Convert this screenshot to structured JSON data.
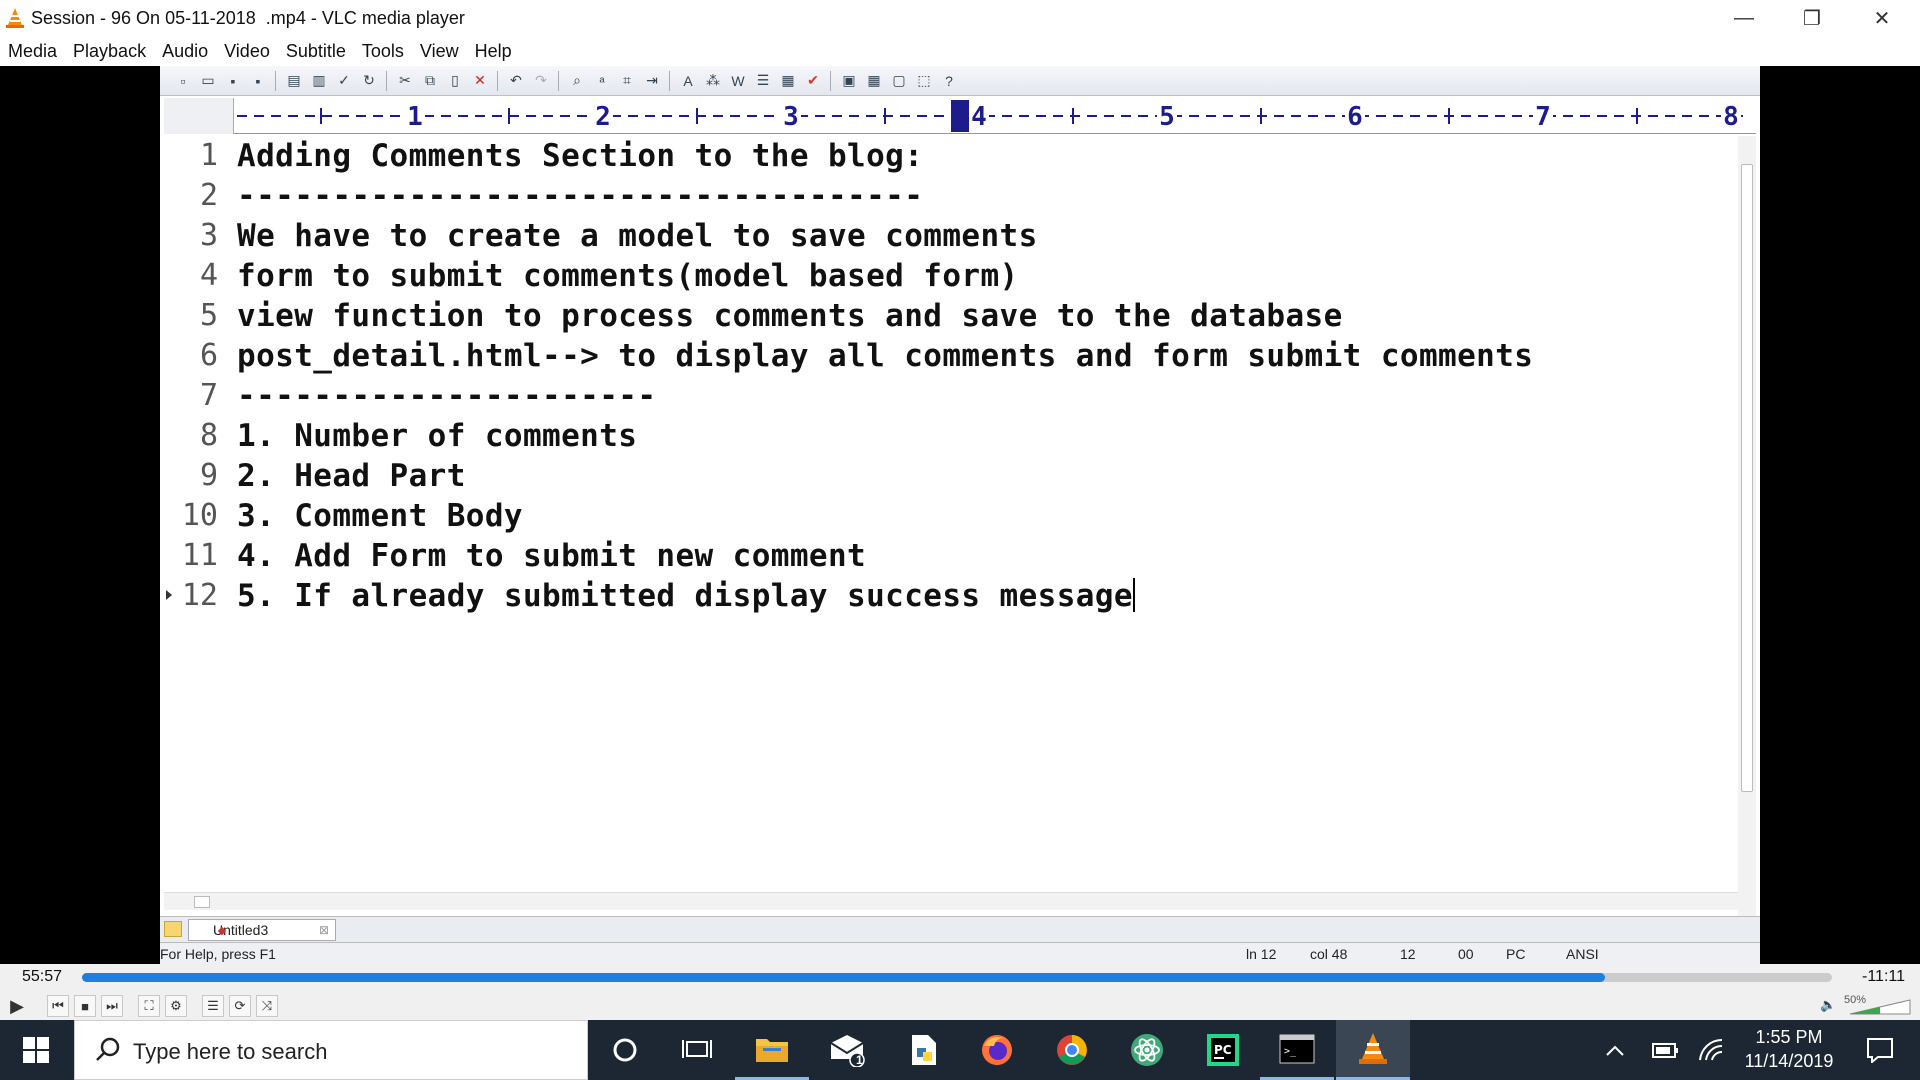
{
  "window": {
    "title": "Session - 96 On 05-11-2018  .mp4 - VLC media player",
    "minimize": "—",
    "restore": "❐",
    "close": "✕"
  },
  "menu": [
    "Media",
    "Playback",
    "Audio",
    "Video",
    "Subtitle",
    "Tools",
    "View",
    "Help"
  ],
  "editor": {
    "ruler_numbers": [
      "1",
      "2",
      "3",
      "4",
      "5",
      "6",
      "7",
      "8"
    ],
    "lines": [
      {
        "n": "1",
        "text": "Adding Comments Section to the blog:"
      },
      {
        "n": "2",
        "text": "------------------------------------"
      },
      {
        "n": "3",
        "text": "We have to create a model to save comments"
      },
      {
        "n": "4",
        "text": "form to submit comments(model based form)"
      },
      {
        "n": "5",
        "text": "view function to process comments and save to the database"
      },
      {
        "n": "6",
        "text": "post_detail.html--> to display all comments and form submit comments"
      },
      {
        "n": "7",
        "text": "----------------------"
      },
      {
        "n": "8",
        "text": "1. Number of comments"
      },
      {
        "n": "9",
        "text": "2. Head Part"
      },
      {
        "n": "10",
        "text": "3. Comment Body"
      },
      {
        "n": "11",
        "text": "4. Add Form to submit new comment"
      },
      {
        "n": "12",
        "text": "5. If already submitted display success message"
      }
    ],
    "tab_name": "Untitled3",
    "status": {
      "help": "For Help, press F1",
      "line": "ln 12",
      "col": "col 48",
      "num": "12",
      "code": "00",
      "mode": "PC",
      "encoding": "ANSI"
    }
  },
  "player": {
    "elapsed": "55:57",
    "remaining": "-11:11",
    "progress_fraction": 0.87,
    "volume_percent": "50%"
  },
  "taskbar": {
    "search_placeholder": "Type here to search",
    "time": "1:55 PM",
    "date": "11/14/2019",
    "mail_badge": "1",
    "accent": "#8cb8e8"
  }
}
